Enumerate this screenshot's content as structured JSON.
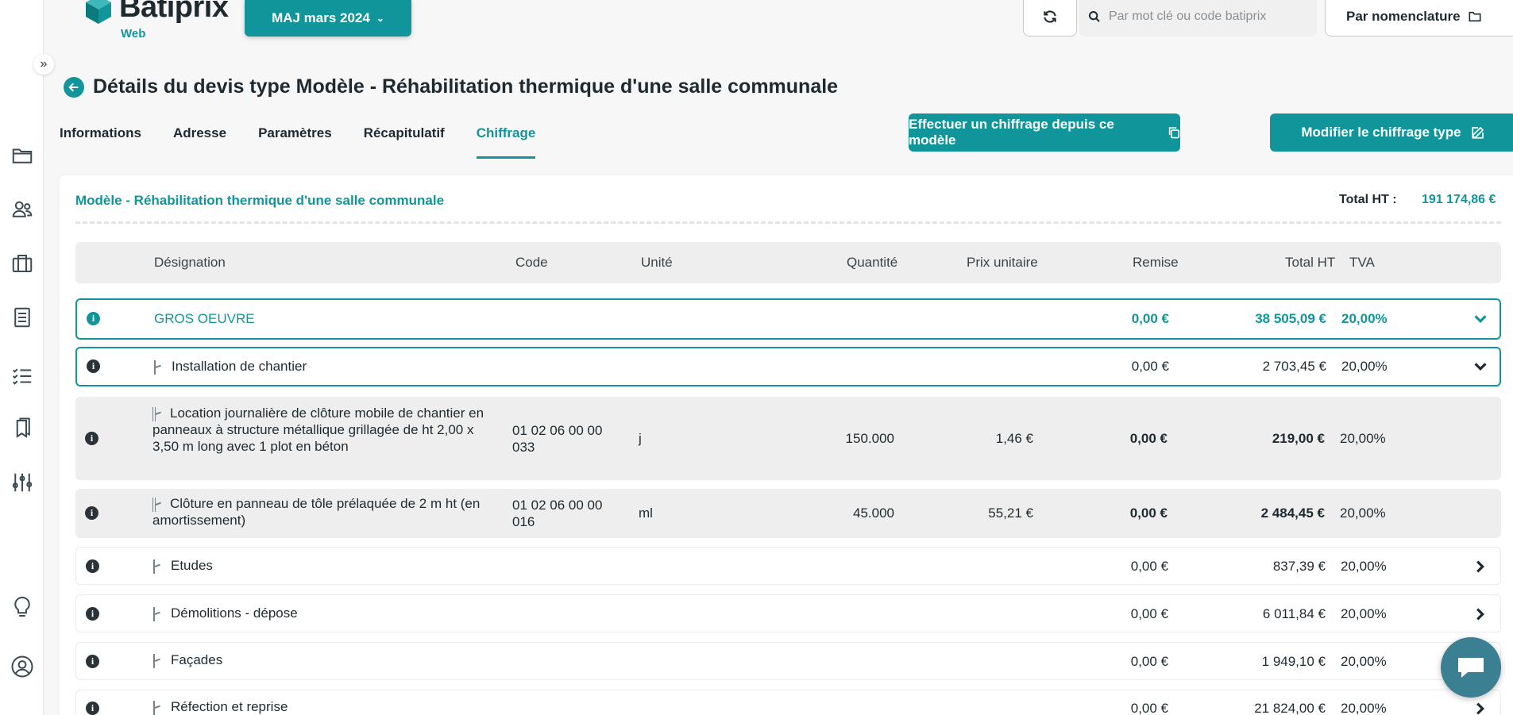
{
  "header": {
    "logo_text": "Batiprix",
    "logo_sub": "Web",
    "maj_label": "MAJ mars 2024",
    "search_placeholder": "Par mot clé ou code batiprix",
    "nomenclature_label": "Par nomenclature"
  },
  "sidebar": {
    "icons": [
      "folder-icon",
      "users-icon",
      "briefcase-icon",
      "document-icon",
      "checklist-icon",
      "bookmarks-icon",
      "sliders-icon",
      "lightbulb-icon",
      "account-icon"
    ]
  },
  "page": {
    "title": "Détails du devis type Modèle - Réhabilitation thermique d'une salle communale",
    "tabs": [
      "Informations",
      "Adresse",
      "Paramètres",
      "Récapitulatif",
      "Chiffrage"
    ],
    "active_tab": "Chiffrage",
    "btn_chiffrage": "Effectuer un chiffrage depuis ce modèle",
    "btn_modifier": "Modifier le chiffrage type"
  },
  "card": {
    "title": "Modèle - Réhabilitation thermique d'une salle communale",
    "total_label": "Total HT :",
    "total_value": "191 174,86 €"
  },
  "table": {
    "headers": {
      "designation": "Désignation",
      "code": "Code",
      "unite": "Unité",
      "quantite": "Quantité",
      "prix": "Prix unitaire",
      "remise": "Remise",
      "total": "Total HT",
      "tva": "TVA"
    },
    "rows": [
      {
        "designation": "GROS OEUVRE",
        "remise": "0,00 €",
        "total": "38 505,09 €",
        "tva": "20,00%"
      },
      {
        "designation": "Installation de chantier",
        "remise": "0,00 €",
        "total": "2 703,45 €",
        "tva": "20,00%"
      },
      {
        "designation": "Location journalière de clôture mobile de chantier en panneaux à structure métallique grillagée de ht 2,00 x 3,50 m long avec 1 plot en béton",
        "code": "01 02 06 00 00 033",
        "unite": "j",
        "quantite": "150.000",
        "prix": "1,46 €",
        "remise": "0,00 €",
        "total": "219,00 €",
        "tva": "20,00%"
      },
      {
        "designation": "Clôture en panneau de tôle prélaquée de 2 m ht (en amortissement)",
        "code": "01 02 06 00 00 016",
        "unite": "ml",
        "quantite": "45.000",
        "prix": "55,21 €",
        "remise": "0,00 €",
        "total": "2 484,45 €",
        "tva": "20,00%"
      },
      {
        "designation": "Etudes",
        "remise": "0,00 €",
        "total": "837,39 €",
        "tva": "20,00%"
      },
      {
        "designation": "Démolitions - dépose",
        "remise": "0,00 €",
        "total": "6 011,84 €",
        "tva": "20,00%"
      },
      {
        "designation": "Façades",
        "remise": "0,00 €",
        "total": "1 949,10 €",
        "tva": "20,00%"
      },
      {
        "designation": "Réfection et reprise",
        "remise": "0,00 €",
        "total": "21 824,00 €",
        "tva": "20,00%"
      }
    ]
  },
  "colors": {
    "accent": "#10969a",
    "chat": "#3a7f92"
  }
}
